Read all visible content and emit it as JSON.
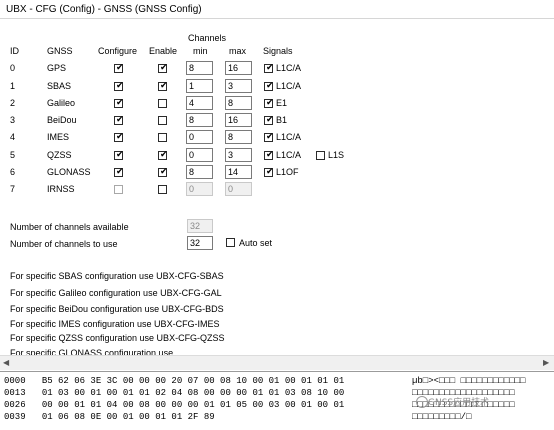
{
  "window": {
    "title": "UBX - CFG (Config) - GNSS (GNSS Config)"
  },
  "columns": {
    "id": "ID",
    "gnss": "GNSS",
    "configure": "Configure",
    "enable": "Enable",
    "channels": "Channels",
    "min": "min",
    "max": "max",
    "signals": "Signals"
  },
  "rows": [
    {
      "id": "0",
      "gnss": "GPS",
      "configure": true,
      "enable": true,
      "min": "8",
      "max": "16",
      "enabled_inputs": true,
      "signals": [
        {
          "checked": true,
          "label": "L1C/A"
        }
      ]
    },
    {
      "id": "1",
      "gnss": "SBAS",
      "configure": true,
      "enable": true,
      "min": "1",
      "max": "3",
      "enabled_inputs": true,
      "signals": [
        {
          "checked": true,
          "label": "L1C/A"
        }
      ]
    },
    {
      "id": "2",
      "gnss": "Galileo",
      "configure": true,
      "enable": false,
      "min": "4",
      "max": "8",
      "enabled_inputs": true,
      "signals": [
        {
          "checked": true,
          "label": "E1"
        }
      ]
    },
    {
      "id": "3",
      "gnss": "BeiDou",
      "configure": true,
      "enable": false,
      "min": "8",
      "max": "16",
      "enabled_inputs": true,
      "signals": [
        {
          "checked": true,
          "label": "B1"
        }
      ]
    },
    {
      "id": "4",
      "gnss": "IMES",
      "configure": true,
      "enable": false,
      "min": "0",
      "max": "8",
      "enabled_inputs": true,
      "signals": [
        {
          "checked": true,
          "label": "L1C/A"
        }
      ]
    },
    {
      "id": "5",
      "gnss": "QZSS",
      "configure": true,
      "enable": true,
      "min": "0",
      "max": "3",
      "enabled_inputs": true,
      "signals": [
        {
          "checked": true,
          "label": "L1C/A"
        },
        {
          "checked": false,
          "label": "L1S"
        }
      ]
    },
    {
      "id": "6",
      "gnss": "GLONASS",
      "configure": true,
      "enable": true,
      "min": "8",
      "max": "14",
      "enabled_inputs": true,
      "signals": [
        {
          "checked": true,
          "label": "L1OF"
        }
      ]
    },
    {
      "id": "7",
      "gnss": "IRNSS",
      "configure": false,
      "enable": false,
      "min": "0",
      "max": "0",
      "enabled_inputs": false,
      "signals": []
    }
  ],
  "summary": {
    "available_label": "Number of channels available",
    "available_value": "32",
    "to_use_label": "Number of channels to use",
    "to_use_value": "32",
    "auto_set_label": "Auto set",
    "auto_set_checked": false
  },
  "notes": [
    "For specific SBAS configuration use UBX-CFG-SBAS",
    "For specific Galileo configuration use UBX-CFG-GAL",
    "For specific BeiDou configuration use UBX-CFG-BDS",
    "For specific IMES configuration use UBX-CFG-IMES",
    "For specific QZSS configuration use UBX-CFG-QZSS",
    "For specific GLONASS configuration use"
  ],
  "hex_dump": [
    {
      "offset": "0000",
      "bytes": "B5 62 06 3E 3C 00 00 00 20 07 00 08 10 00 01 00 01 01 01",
      "ascii": "µb□><□□□ □□□□□□□□□□□□"
    },
    {
      "offset": "0013",
      "bytes": "01 03 00 01 00 01 01 02 04 08 00 00 00 01 01 03 08 10 00",
      "ascii": "□□□□□□□□□□□□□□□□□□□"
    },
    {
      "offset": "0026",
      "bytes": "00 00 01 01 04 00 08 00 00 00 01 01 05 00 03 00 01 00 01",
      "ascii": "□□□□□□□□□□□□□□□□□□□"
    },
    {
      "offset": "0039",
      "bytes": "01 06 08 0E 00 01 00 01 01 2F 89",
      "ascii": "□□□□□□□□□/□"
    }
  ],
  "watermark": "GNSS应用技术",
  "colors": {
    "input_border": "#7a7a7a",
    "disabled_bg": "#f0f0f0",
    "separator": "#d6d6d6"
  }
}
